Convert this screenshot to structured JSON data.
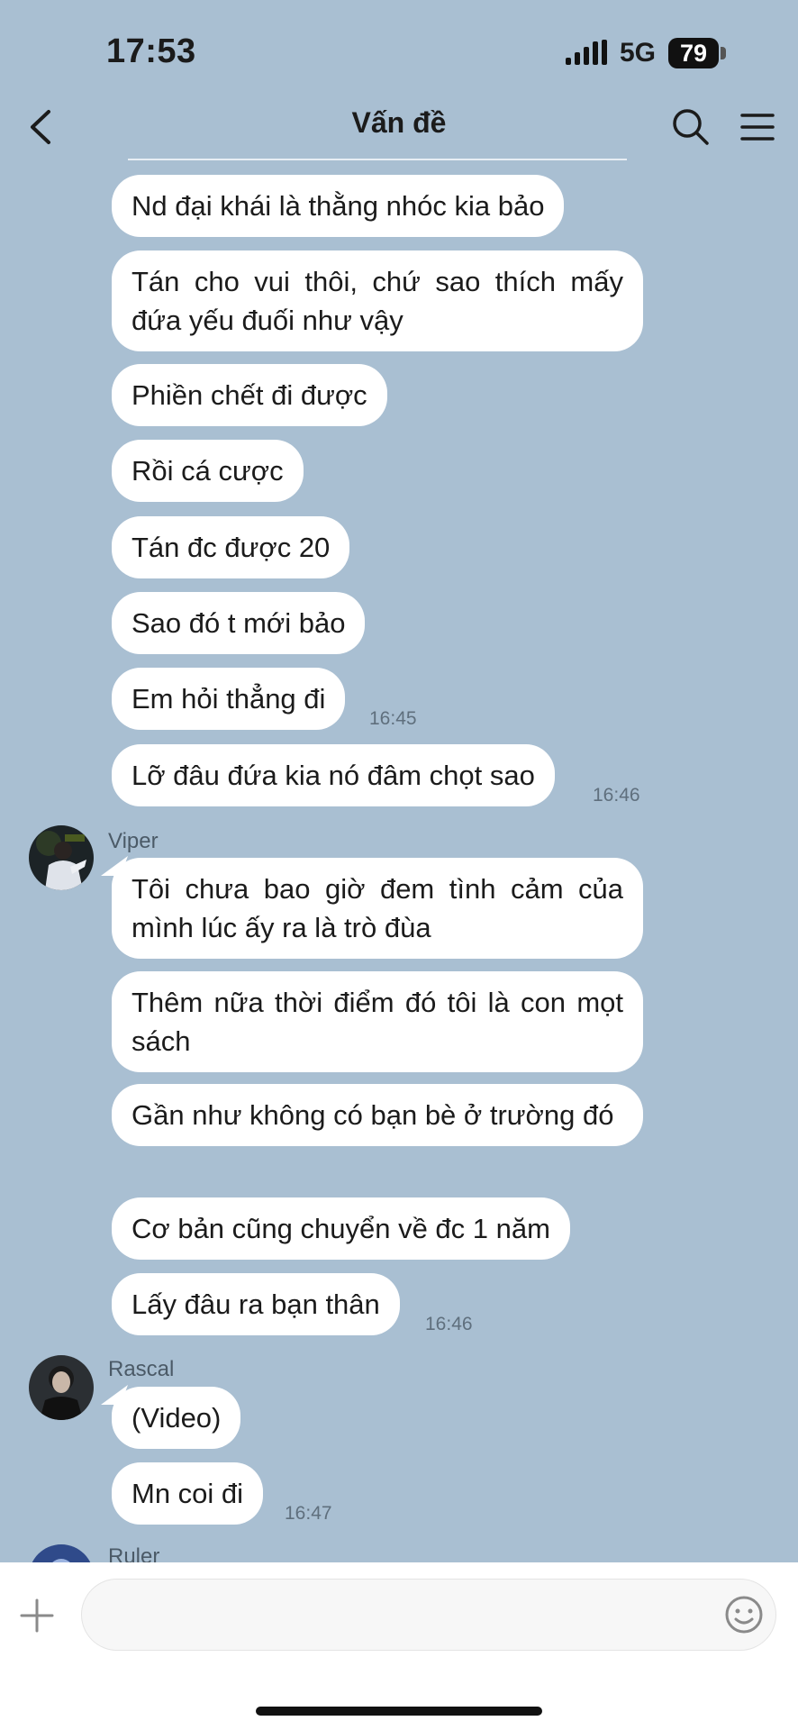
{
  "status": {
    "time": "17:53",
    "network": "5G",
    "battery": "79"
  },
  "header": {
    "title": "Vấn đề"
  },
  "messages": [
    {
      "text": "Nd đại khái là thằng nhóc kia bảo"
    },
    {
      "text": "Tán cho vui thôi, chứ sao thích mấy đứa yếu đuối như vậy"
    },
    {
      "text": "Phiền chết đi được"
    },
    {
      "text": "Rồi cá cược"
    },
    {
      "text": "Tán đc được 20"
    },
    {
      "text": "Sao đó t mới bảo"
    },
    {
      "text": "Em hỏi thẳng đi",
      "time": "16:45"
    },
    {
      "text": "Lỡ đâu đứa kia nó đâm chọt sao",
      "time": "16:46"
    }
  ],
  "viper": {
    "name": "Viper",
    "messages": [
      {
        "text": "Tôi chưa bao giờ đem tình cảm của mình lúc ấy ra là trò đùa"
      },
      {
        "text": "Thêm nữa thời điểm đó tôi là con mọt sách"
      },
      {
        "text": "Gần như không có bạn bè ở trường đó"
      },
      {
        "text": "Cơ bản cũng chuyển về đc 1 năm"
      },
      {
        "text": "Lấy đâu ra bạn thân",
        "time": "16:46"
      }
    ]
  },
  "rascal": {
    "name": "Rascal",
    "messages": [
      {
        "text": "(Video)"
      },
      {
        "text": "Mn coi đi",
        "time": "16:47"
      }
    ]
  },
  "ruler": {
    "name": "Ruler"
  },
  "input": {
    "placeholder": ""
  },
  "icons": {
    "back": "chevron-left-icon",
    "search": "search-icon",
    "menu": "menu-icon",
    "plus": "plus-icon",
    "emoji": "emoji-icon"
  }
}
